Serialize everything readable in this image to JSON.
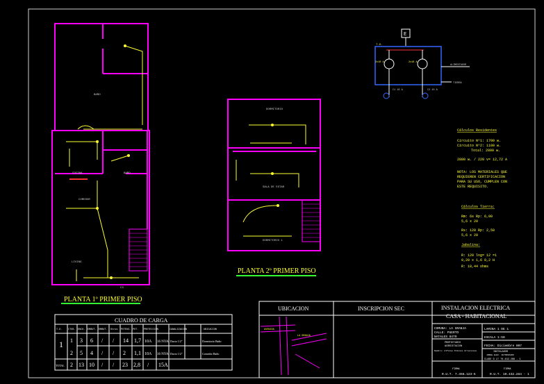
{
  "plan1": {
    "title": "PLANTA 1º PRIMER PISO",
    "room_top": "BAÑO",
    "room_kitchen": "COCINA",
    "room_bath": "BAÑO",
    "room_dining": "COMEDOR",
    "room_living": "LIVING",
    "spot_label": "C3"
  },
  "plan2": {
    "title": "PLANTA 2º PRIMER PISO",
    "room_top": "DORMITORIO",
    "room_mid": "SALA DE ESTAR",
    "room_bottom": "DORMITORIO 1"
  },
  "single_line": {
    "meter": "E",
    "td": "T.D.",
    "c1": "C1 16 A",
    "c2": "C2 10 A",
    "breaker1": "2x10 A",
    "breaker2": "2x16 A",
    "ground": "TIERRA",
    "note": "ALIMENTADOR"
  },
  "calc_residential": {
    "title": "Cálculos Residentes",
    "lines": [
      "Circuito Nº1: 1700 w.",
      "Circuito Nº2: 1100 w.",
      "Total: 2800 w.",
      "2800 w. / 220 v= 12,72 A"
    ],
    "note": [
      "NOTA: LOS MATERIALES QUE",
      "REQUIEREN CERTIFICACION",
      "PARA SU USO, CUMPLEN CON",
      "ESTE REQUISITO."
    ]
  },
  "calc_tierra": {
    "title": "Cálculos Tierra:",
    "lines": [
      "Rm: 6s    Rp: 6,00",
      "  5,6 x 20",
      "Rs: 120   Rp: 2,50",
      "  5,6 x 20",
      "Jabalina:",
      "R: 120    lng=  12    =1",
      "  0,20 x 1,6     0,2 H",
      "R: 18,44 ohms"
    ]
  },
  "cuadro": {
    "title": "CUADRO DE CARGA",
    "headers": [
      "T.D.",
      "CTOS.",
      "ENCH.",
      "EMBUT.",
      "EMBUT.",
      "Otros",
      "POTENC.",
      "POT.",
      "PROTECCION",
      "CANALIZACION",
      "UBICACION"
    ],
    "row1": [
      "1",
      "1",
      "3",
      "6",
      "/",
      "/",
      "14",
      "1,7",
      "10A",
      "16 NYA",
      "Ducto 1/2\"",
      "Dormitorio Baño"
    ],
    "row2": [
      "2",
      "5",
      "4",
      "/",
      "/",
      "2",
      "1,1",
      "10A",
      "16 NYA",
      "Ducto 1/2\"",
      "Comedor Baño"
    ],
    "total": [
      "TOTAL",
      "2",
      "13",
      "10",
      "/",
      "/",
      "23",
      "2,8",
      "/",
      "15A"
    ]
  },
  "ubicacion": {
    "title": "UBICACION",
    "street1": "LA GRANJA",
    "street2": "AVENIDA"
  },
  "sec": {
    "title": "INSCRIPCION SEC"
  },
  "title_block": {
    "title1": "INSTALACION ELECTRICA",
    "title2": "CASA - HABITACIONAL",
    "comuna": "COMUNA: LA GRANJA",
    "calle": "CALLE: PUERTO",
    "natales": "NATALES 8479",
    "prop_label": "PROPIETARIO",
    "prop_name": "ACREDITACION",
    "owner": "Nombre: Alfonso Ordenes Arrocensos",
    "lamina": "LAMINA 1 DE 1",
    "escala": "ESCALA 1:50",
    "fecha": "FECHA: Diciembre 007",
    "inst": "INSTALADOR",
    "inst_sub": "JORGE ELEC. AUTORIZADO",
    "clase": "CLASE D LT 76.432.286 - 1",
    "firma1": "FIRMA",
    "rut1": "R.U.T. 7.456.123-5",
    "firma2": "FIRMA",
    "rut2": "R.U.T. 10.432.284 - 1"
  }
}
